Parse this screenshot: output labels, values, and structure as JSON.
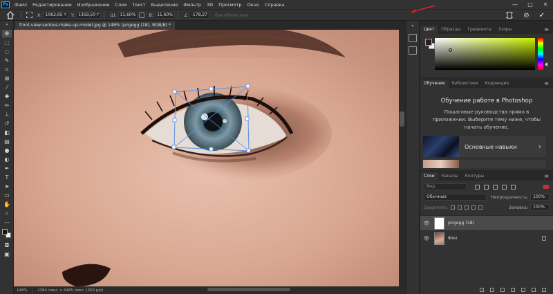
{
  "app": {
    "logo": "Ps"
  },
  "menu": [
    "Файл",
    "Редактирование",
    "Изображение",
    "Слои",
    "Текст",
    "Выделение",
    "Фильтр",
    "3D",
    "Просмотр",
    "Окно",
    "Справка"
  ],
  "window_controls": [
    "—",
    "□",
    "✕"
  ],
  "options": {
    "x_label": "X:",
    "x_value": "1062,65 т",
    "y_label": "Y:",
    "y_value": "1359,50 т",
    "w_label": "Ш:",
    "w_value": "11,60%",
    "h_label": "В:",
    "h_value": "11,60%",
    "angle_label": "∠",
    "angle_value": "-178,27",
    "interp_value": "Бикубическая",
    "cancel_label": "⊘",
    "commit_label": "✓"
  },
  "document": {
    "tab_title": "front-view-serious-make-up-model.jpg @ 148% (pngegg (18), RGB/8) *",
    "zoom": "148%",
    "status": "2384 пикс. x 4485 пикс. (300 ppi)"
  },
  "color_panel": {
    "tabs": [
      "Цвет",
      "Образцы",
      "Градиенты",
      "Узоры"
    ],
    "active_tab": 0,
    "foreground": "#2a1e18",
    "hue_color": "#c8f000"
  },
  "learn_panel": {
    "tabs": [
      "Обучение",
      "Библиотеки",
      "Коррекция"
    ],
    "title": "Обучение работе в Photoshop",
    "description": "Пошаговые руководства прямо в приложении. Выберите тему ниже, чтобы начать обучение.",
    "card_label": "Основные навыки"
  },
  "layers_panel": {
    "tabs": [
      "Слои",
      "Каналы",
      "Контуры"
    ],
    "filter_placeholder": "Вид",
    "blend_mode": "Обычные",
    "opacity_label": "Непрозрачность:",
    "opacity_value": "100%",
    "lock_label": "Закрепить:",
    "fill_label": "Заливка:",
    "fill_value": "100%",
    "layers": [
      {
        "name": "pngegg (18)",
        "selected": true
      },
      {
        "name": "Фон",
        "selected": false
      }
    ]
  },
  "accent": {
    "annotation_arrow": "#e02020",
    "transform_handles": "#5a8fe8"
  }
}
